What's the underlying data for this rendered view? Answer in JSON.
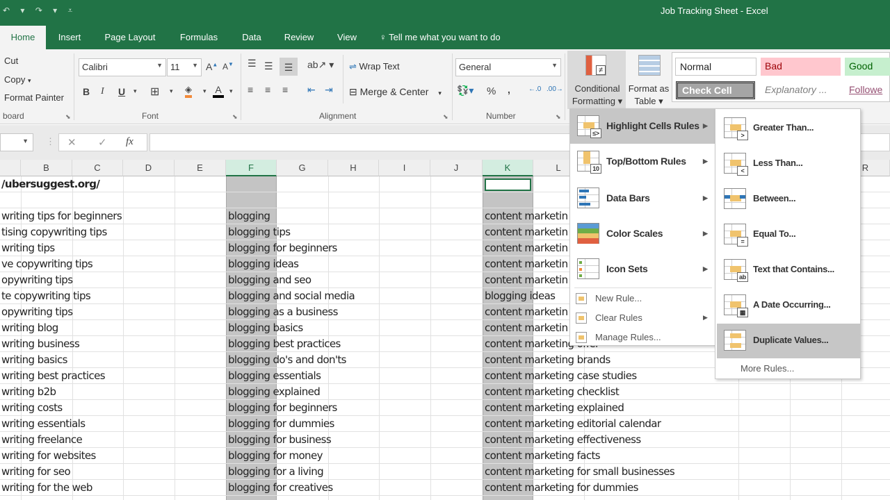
{
  "window": {
    "title": "Job Tracking Sheet  -  Excel",
    "qat": "↶ ▾  ↷ ▾  ⩡"
  },
  "tabs": [
    {
      "label": "Home",
      "active": true
    },
    {
      "label": "Insert"
    },
    {
      "label": "Page Layout"
    },
    {
      "label": "Formulas"
    },
    {
      "label": "Data"
    },
    {
      "label": "Review"
    },
    {
      "label": "View"
    }
  ],
  "tell_me": "Tell me what you want to do",
  "ribbon": {
    "clipboard": {
      "cut": "Cut",
      "copy": "Copy",
      "format_painter": "Format Painter",
      "label": "board"
    },
    "font": {
      "name": "Calibri",
      "size": "11",
      "label": "Font",
      "bold": "B",
      "italic": "I",
      "underline": "U"
    },
    "alignment": {
      "wrap_text": "Wrap Text",
      "merge_center": "Merge & Center",
      "label": "Alignment"
    },
    "number": {
      "format": "General",
      "percent": "%",
      "comma": ",",
      "label": "Number"
    },
    "styles": {
      "conditional_formatting": [
        "Conditional",
        "Formatting ▾"
      ],
      "format_as_table": [
        "Format as",
        "Table ▾"
      ],
      "normal": "Normal",
      "bad": "Bad",
      "good": "Good",
      "check_cell": "Check Cell",
      "explanatory": "Explanatory ...",
      "followed": "Followe"
    }
  },
  "formula_bar": {
    "fx": "fx",
    "cancel": "✕",
    "enter": "✓",
    "value": ""
  },
  "columns": [
    "B",
    "C",
    "D",
    "E",
    "F",
    "G",
    "H",
    "I",
    "J",
    "K",
    "L",
    "R"
  ],
  "sheet": {
    "row1_b": "/ubersuggest.org/",
    "col_b": [
      "writing tips for beginners",
      "tising copywriting tips",
      "writing tips",
      "ve copywriting tips",
      "opywriting tips",
      "te copywriting tips",
      "opywriting tips",
      "writing blog",
      "writing business",
      "writing basics",
      "writing best practices",
      "writing b2b",
      "writing costs",
      "writing essentials",
      "writing freelance",
      "writing for websites",
      "writing for seo",
      "writing for the web"
    ],
    "col_f": [
      "blogging",
      "blogging tips",
      "blogging for beginners",
      "blogging ideas",
      "blogging and seo",
      "blogging and social media",
      "blogging as a business",
      "blogging basics",
      "blogging best practices",
      "blogging do's and don'ts",
      "blogging essentials",
      "blogging explained",
      "blogging for beginners",
      "blogging for dummies",
      "blogging for business",
      "blogging for money",
      "blogging for a living",
      "blogging for creatives"
    ],
    "col_k": [
      "content marketin",
      "content marketin",
      "content marketin",
      "content marketin",
      "content marketin",
      "blogging ideas",
      "content marketin",
      "content marketin",
      "content marketing offer",
      "content marketing brands",
      "content marketing case studies",
      "content marketing checklist",
      "content marketing explained",
      "content marketing editorial calendar",
      "content marketing effectiveness",
      "content marketing facts",
      "content marketing for small businesses",
      "content marketing for dummies"
    ]
  },
  "cf_menu": {
    "items": [
      {
        "label": "Highlight Cells Rules",
        "ul": "H",
        "highlighted": true,
        "badge": "≤>"
      },
      {
        "label": "Top/Bottom Rules",
        "ul": "T",
        "badge": "10"
      },
      {
        "label": "Data Bars",
        "ul": "D"
      },
      {
        "label": "Color Scales",
        "ul": "S"
      },
      {
        "label": "Icon Sets",
        "ul": "I"
      }
    ],
    "small": [
      {
        "label": "New Rule..."
      },
      {
        "label": "Clear Rules",
        "submenu": true
      },
      {
        "label": "Manage Rules..."
      }
    ]
  },
  "highlight_submenu": {
    "items": [
      {
        "label": "Greater Than...",
        "badge": ">"
      },
      {
        "label": "Less Than...",
        "badge": "<"
      },
      {
        "label": "Between...",
        "badge": ""
      },
      {
        "label": "Equal To...",
        "badge": "="
      },
      {
        "label": "Text that Contains...",
        "badge": "ab"
      },
      {
        "label": "A Date Occurring...",
        "badge": "▦"
      },
      {
        "label": "Duplicate Values...",
        "badge": "",
        "highlighted": true
      }
    ],
    "more": "More Rules..."
  }
}
